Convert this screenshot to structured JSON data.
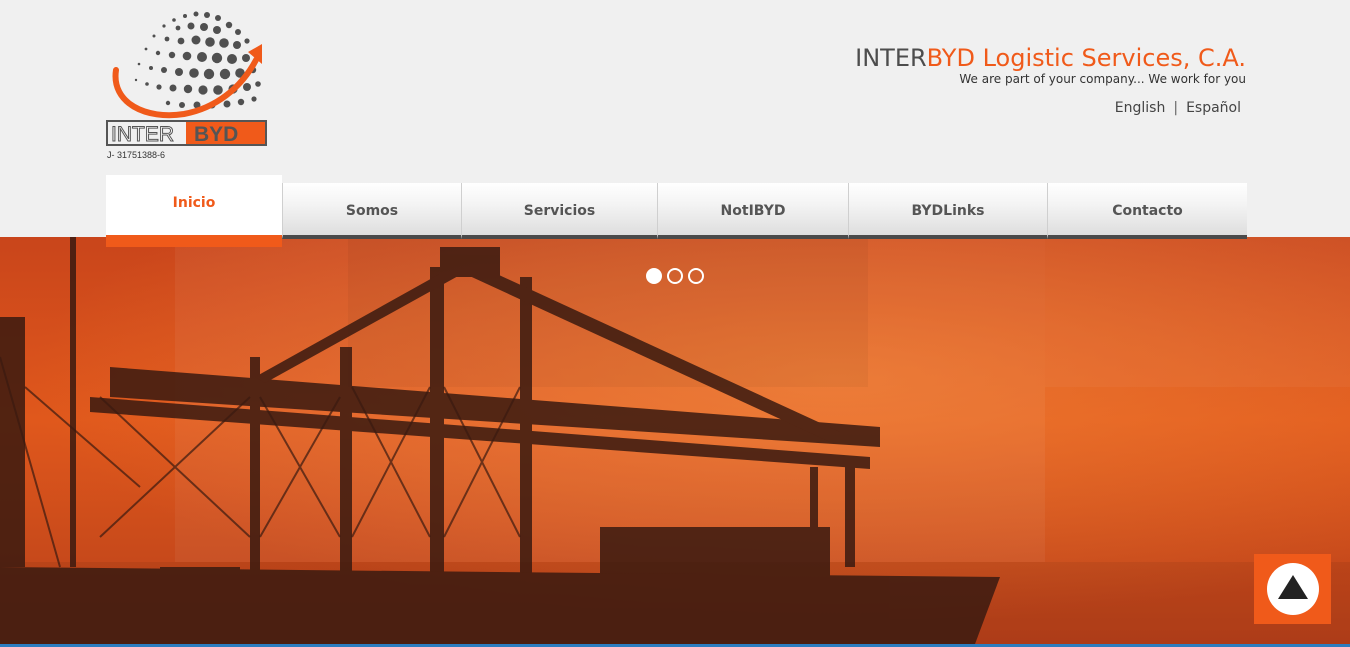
{
  "brand": {
    "name_part1": "INTER",
    "name_part2": "BYD Logistic Services, C.A.",
    "tagline": "We are part of your company... We work for you",
    "logo_text_left": "INTER",
    "logo_text_right": "BYD",
    "rif": "J- 31751388-6"
  },
  "languages": {
    "english": "English",
    "separator": "|",
    "spanish": "Español"
  },
  "nav": {
    "items": [
      {
        "label": "Inicio",
        "active": true
      },
      {
        "label": "Somos"
      },
      {
        "label": "Servicios"
      },
      {
        "label": "NotIBYD"
      },
      {
        "label": "BYDLinks"
      },
      {
        "label": "Contacto"
      }
    ]
  },
  "slider": {
    "slide_count": 3,
    "active_slide": 1
  },
  "colors": {
    "accent": "#f05a1a",
    "dark": "#4d4d4d",
    "hero": "#e0541a",
    "bottom_bar": "#2b7dc0"
  },
  "icons": {
    "back_to_top": "up-arrow-icon"
  }
}
